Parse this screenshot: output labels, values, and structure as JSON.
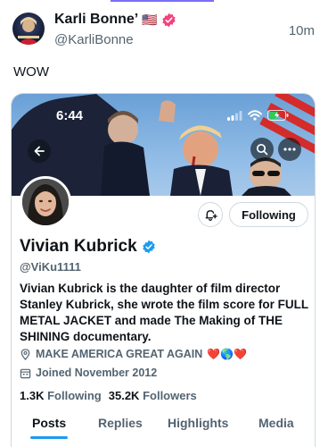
{
  "tweet": {
    "author_name": "Karli Bonne’",
    "flag": "🇺🇸",
    "handle": "@KarliBonne",
    "time": "10m",
    "text": "WOW"
  },
  "screenshot": {
    "status_time": "6:44",
    "profile": {
      "name": "Vivian Kubrick",
      "handle": "@ViKu1111",
      "bio": "Vivian Kubrick is the daughter of film director Stanley Kubrick, she wrote the film score for FULL METAL JACKET and made The Making of THE SHINING documentary.",
      "location": "MAKE AMERICA GREAT AGAIN",
      "location_emojis": "❤️🌎❤️",
      "joined": "Joined November 2012",
      "following_count": "1.3K",
      "following_label": "Following",
      "followers_count": "35.2K",
      "followers_label": "Followers",
      "follow_button": "Following"
    },
    "tabs": [
      {
        "label": "Posts",
        "active": true
      },
      {
        "label": "Replies",
        "active": false
      },
      {
        "label": "Highlights",
        "active": false
      },
      {
        "label": "Media",
        "active": false
      }
    ]
  },
  "icons": {
    "verified": "verified-badge-icon",
    "back": "back-arrow-icon",
    "search": "search-icon",
    "more": "more-dots-icon",
    "notify": "bell-plus-icon",
    "location": "location-pin-icon",
    "calendar": "calendar-icon",
    "signal": "signal-icon",
    "wifi": "wifi-icon",
    "battery": "battery-icon"
  },
  "colors": {
    "verified_pink": "#f4427d",
    "verified_blue": "#1d9bf0",
    "accent": "#1d9bf0",
    "text_primary": "#0f1419",
    "text_secondary": "#536471"
  }
}
